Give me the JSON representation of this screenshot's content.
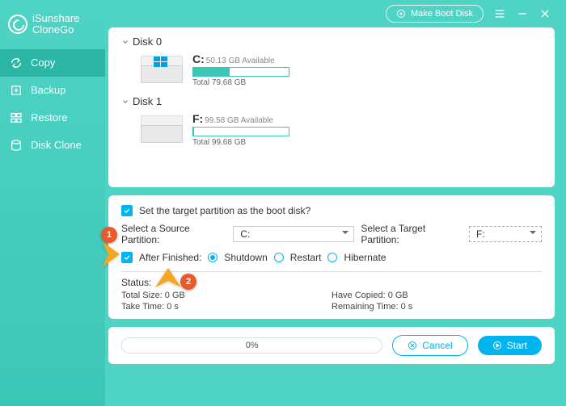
{
  "app": {
    "brand_line1": "iSunshare",
    "brand_line2": "CloneGo"
  },
  "topbar": {
    "make_boot": "Make Boot Disk"
  },
  "sidebar": {
    "items": [
      {
        "label": "Copy"
      },
      {
        "label": "Backup"
      },
      {
        "label": "Restore"
      },
      {
        "label": "Disk Clone"
      }
    ]
  },
  "disks": [
    {
      "name": "Disk 0",
      "letter": "C:",
      "available": "50.13 GB Available",
      "total": "Total 79.68 GB",
      "fill_pct": 38,
      "is_windows": true
    },
    {
      "name": "Disk 1",
      "letter": "F:",
      "available": "99.58 GB Available",
      "total": "Total 99.68 GB",
      "fill_pct": 1,
      "is_windows": false
    }
  ],
  "options": {
    "boot_checkbox_label": "Set the target partition as the boot disk?",
    "source_label": "Select a Source Partition:",
    "source_value": "C:",
    "target_label": "Select a Target Partition:",
    "target_value": "F:",
    "after_finished_label": "After Finished:",
    "radios": {
      "shutdown": "Shutdown",
      "restart": "Restart",
      "hibernate": "Hibernate"
    }
  },
  "status": {
    "title": "Status:",
    "total_size": "Total Size: 0 GB",
    "take_time": "Take Time: 0 s",
    "have_copied": "Have Copied: 0 GB",
    "remaining": "Remaining Time: 0 s"
  },
  "progress": {
    "percent": "0%",
    "cancel": "Cancel",
    "start": "Start"
  },
  "callouts": {
    "one": "1",
    "two": "2"
  }
}
